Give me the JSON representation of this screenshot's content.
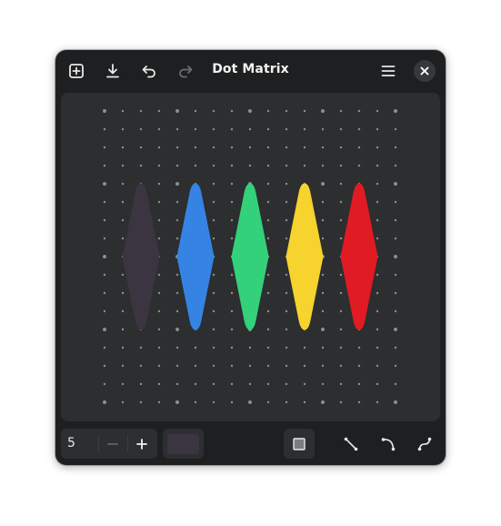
{
  "window": {
    "title": "Dot Matrix"
  },
  "header": {
    "new_button": "new-icon",
    "save_button": "download-icon",
    "undo_button": "undo-icon",
    "redo_button": "redo-icon",
    "redo_enabled": false,
    "menu_button": "hamburger-menu-icon",
    "close_button": "close-icon"
  },
  "canvas": {
    "background": "#2c2e2f",
    "dot_color": "#8c8e90",
    "grid_columns": 17,
    "grid_rows": 17,
    "shapes": [
      {
        "type": "diamond",
        "color": "#3a3541"
      },
      {
        "type": "diamond",
        "color": "#3584e4"
      },
      {
        "type": "diamond",
        "color": "#33d17a"
      },
      {
        "type": "diamond",
        "color": "#f6d32d"
      },
      {
        "type": "diamond",
        "color": "#e01b24"
      }
    ]
  },
  "toolbar": {
    "stroke_width": "5",
    "minus_label": "−",
    "plus_label": "+",
    "current_color": "#3a3541",
    "tools": [
      {
        "name": "rectangle-tool",
        "icon": "square-icon",
        "active": true
      },
      {
        "name": "line-tool",
        "icon": "line-icon",
        "active": false
      },
      {
        "name": "curve-tool",
        "icon": "curve-icon",
        "active": false
      },
      {
        "name": "s-curve-tool",
        "icon": "s-curve-icon",
        "active": false
      }
    ]
  }
}
